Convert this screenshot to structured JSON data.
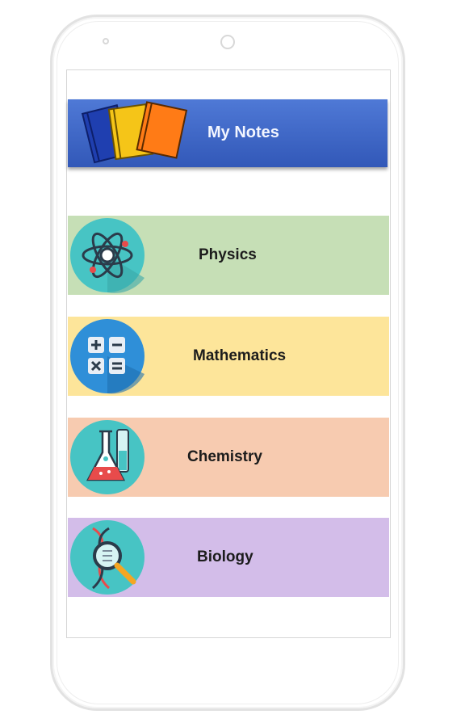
{
  "app": {
    "title": "My Notes"
  },
  "subjects": [
    {
      "label": "Physics",
      "icon": "atom-icon",
      "color": "#c6dfb6"
    },
    {
      "label": "Mathematics",
      "icon": "calculator-icon",
      "color": "#fde59a"
    },
    {
      "label": "Chemistry",
      "icon": "flask-icon",
      "color": "#f7cbb0"
    },
    {
      "label": "Biology",
      "icon": "dna-magnifier-icon",
      "color": "#d3bde9"
    }
  ],
  "colors": {
    "header": "#3f68c8",
    "icon_circle": "#47c4c4"
  }
}
